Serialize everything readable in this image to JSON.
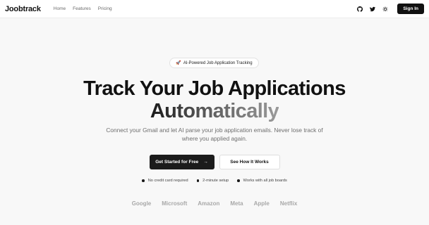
{
  "nav": {
    "brand": "Joobtrack",
    "links": [
      "Home",
      "Features",
      "Pricing"
    ],
    "icons": [
      "github-icon",
      "twitter-icon",
      "theme-icon"
    ],
    "signin_label": "Sign In"
  },
  "hero": {
    "badge_icon": "🚀",
    "badge_text": "AI-Powered Job Application Tracking",
    "headline_line1": "Track Your Job Applications",
    "headline_line2": "Automatically",
    "subtitle": "Connect your Gmail and let AI parse your job application emails. Never lose track of where you applied again.",
    "primary_cta": "Get Started for Free",
    "primary_cta_arrow": "→",
    "secondary_cta": "See How It Works",
    "features": [
      "No credit card required",
      "2-minute setup",
      "Works with all job boards"
    ],
    "logos": [
      "Google",
      "Microsoft",
      "Amazon",
      "Meta",
      "Apple",
      "Netflix"
    ]
  }
}
